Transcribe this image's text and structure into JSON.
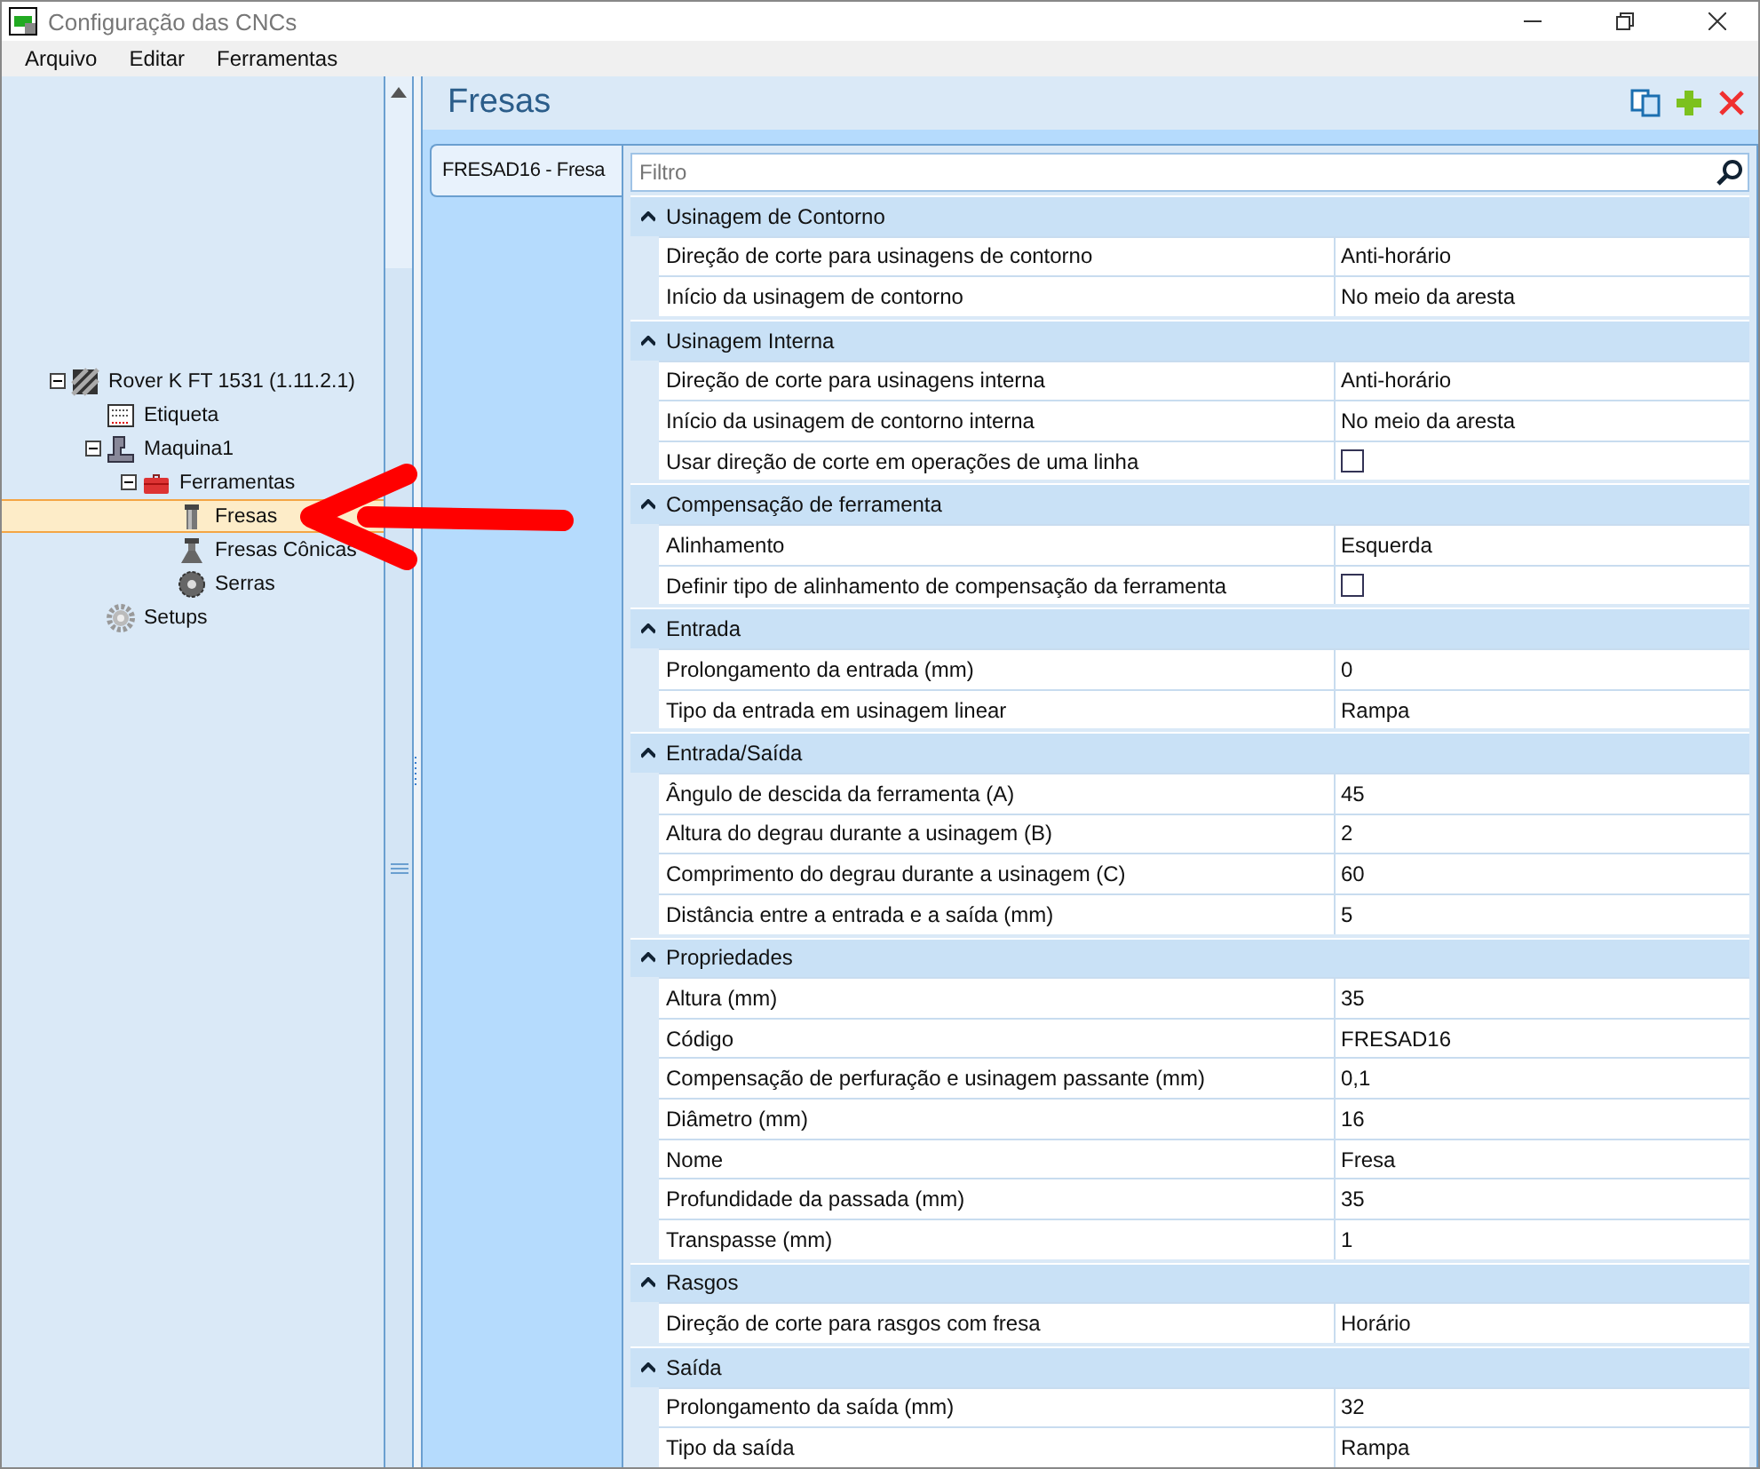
{
  "window": {
    "title": "Configuração das CNCs"
  },
  "menu": [
    "Arquivo",
    "Editar",
    "Ferramentas"
  ],
  "tree": [
    {
      "label": "Rover K FT 1531 (1.11.2.1)",
      "kind": "machine-root",
      "expanded": true,
      "selected": false,
      "children": [
        {
          "label": "Etiqueta",
          "kind": "label",
          "selected": false
        },
        {
          "label": "Maquina1",
          "kind": "machine",
          "expanded": true,
          "selected": false,
          "children": [
            {
              "label": "Ferramentas",
              "kind": "toolbox",
              "expanded": true,
              "selected": false,
              "children": [
                {
                  "label": "Fresas",
                  "kind": "mill",
                  "selected": true
                },
                {
                  "label": "Fresas Cônicas",
                  "kind": "cone-mill",
                  "selected": false
                },
                {
                  "label": "Serras",
                  "kind": "saw",
                  "selected": false
                }
              ]
            }
          ]
        },
        {
          "label": "Setups",
          "kind": "gear",
          "selected": false
        }
      ]
    }
  ],
  "panel": {
    "title": "Fresas"
  },
  "tabs": [
    {
      "label": "FRESAD16 - Fresa",
      "selected": true
    }
  ],
  "filter": {
    "placeholder": "Filtro"
  },
  "categories": [
    {
      "name": "Usinagem de Contorno",
      "expanded": true,
      "properties": [
        {
          "name": "Direção de corte para usinagens de contorno",
          "kind": "text",
          "value": "Anti-horário"
        },
        {
          "name": "Início da usinagem de contorno",
          "kind": "text",
          "value": "No meio da aresta"
        }
      ]
    },
    {
      "name": "Usinagem Interna",
      "expanded": true,
      "properties": [
        {
          "name": "Direção de corte para usinagens interna",
          "kind": "text",
          "value": "Anti-horário"
        },
        {
          "name": "Início da usinagem de contorno interna",
          "kind": "text",
          "value": "No meio da aresta"
        },
        {
          "name": "Usar direção de corte em operações de uma linha",
          "kind": "checkbox",
          "checked": false
        }
      ]
    },
    {
      "name": "Compensação de ferramenta",
      "expanded": true,
      "properties": [
        {
          "name": "Alinhamento",
          "kind": "text",
          "value": "Esquerda"
        },
        {
          "name": "Definir tipo de alinhamento de compensação da ferramenta",
          "kind": "checkbox",
          "checked": false
        }
      ]
    },
    {
      "name": "Entrada",
      "expanded": true,
      "properties": [
        {
          "name": "Prolongamento da entrada (mm)",
          "kind": "text",
          "value": "0"
        },
        {
          "name": "Tipo da entrada em usinagem linear",
          "kind": "text",
          "value": "Rampa"
        }
      ]
    },
    {
      "name": "Entrada/Saída",
      "expanded": true,
      "properties": [
        {
          "name": "Ângulo de descida da ferramenta (A)",
          "kind": "text",
          "value": "45"
        },
        {
          "name": "Altura do degrau durante a usinagem (B)",
          "kind": "text",
          "value": "2"
        },
        {
          "name": "Comprimento do degrau durante a usinagem (C)",
          "kind": "text",
          "value": "60"
        },
        {
          "name": "Distância entre a entrada e a saída (mm)",
          "kind": "text",
          "value": "5"
        }
      ]
    },
    {
      "name": "Propriedades",
      "expanded": true,
      "properties": [
        {
          "name": "Altura (mm)",
          "kind": "text",
          "value": "35"
        },
        {
          "name": "Código",
          "kind": "text",
          "value": "FRESAD16"
        },
        {
          "name": "Compensação de perfuração e usinagem passante (mm)",
          "kind": "text",
          "value": "0,1"
        },
        {
          "name": "Diâmetro (mm)",
          "kind": "text",
          "value": "16"
        },
        {
          "name": "Nome",
          "kind": "text",
          "value": "Fresa"
        },
        {
          "name": "Profundidade da passada (mm)",
          "kind": "text",
          "value": "35"
        },
        {
          "name": "Transpasse (mm)",
          "kind": "text",
          "value": "1"
        }
      ]
    },
    {
      "name": "Rasgos",
      "expanded": true,
      "properties": [
        {
          "name": "Direção de corte para rasgos com fresa",
          "kind": "text",
          "value": "Horário"
        }
      ]
    },
    {
      "name": "Saída",
      "expanded": true,
      "properties": [
        {
          "name": "Prolongamento da saída (mm)",
          "kind": "text",
          "value": "32"
        },
        {
          "name": "Tipo da saída",
          "kind": "text",
          "value": "Rampa"
        }
      ]
    }
  ]
}
